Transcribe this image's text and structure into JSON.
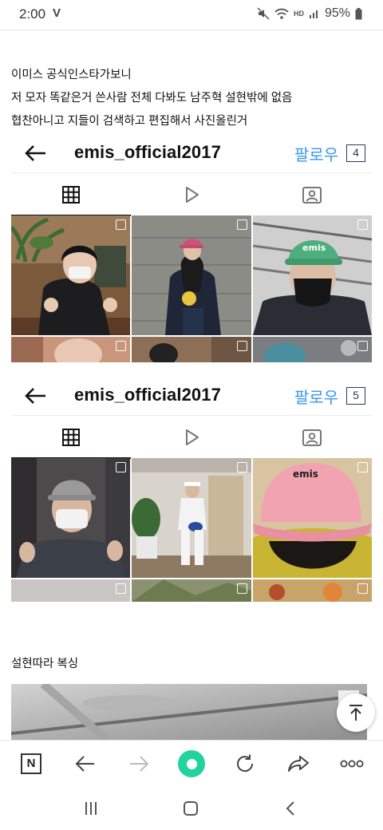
{
  "status_bar": {
    "time": "2:00",
    "carrier_mark": "V",
    "hd_label": "HD",
    "battery": "95%"
  },
  "post": {
    "lines": [
      "이미스 공식인스타가보니",
      "저 모자 똑같은거 쓴사람 전체 다봐도 남주혁 설현밖에 없음",
      "협찬아니고 지들이 검색하고 편집해서 사진올린거"
    ]
  },
  "profile_captures": [
    {
      "username": "emis_official2017",
      "follow_label": "팔로우",
      "badge": "4"
    },
    {
      "username": "emis_official2017",
      "follow_label": "팔로우",
      "badge": "5"
    }
  ],
  "tabs": [
    "grid-icon",
    "reels-icon",
    "tagged-icon"
  ],
  "section2": {
    "text": "설현따라 복싱"
  },
  "toolbar": {
    "home_label": "N",
    "buttons": [
      "naver-home-icon",
      "back-icon",
      "forward-icon",
      "green-dot-icon",
      "refresh-icon",
      "share-icon",
      "more-icon"
    ]
  },
  "navbar": {
    "buttons": [
      "recent-apps-icon",
      "home-icon",
      "back-icon"
    ]
  },
  "colors": {
    "follow": "#3897f0",
    "green_button": "#21d3a0"
  }
}
